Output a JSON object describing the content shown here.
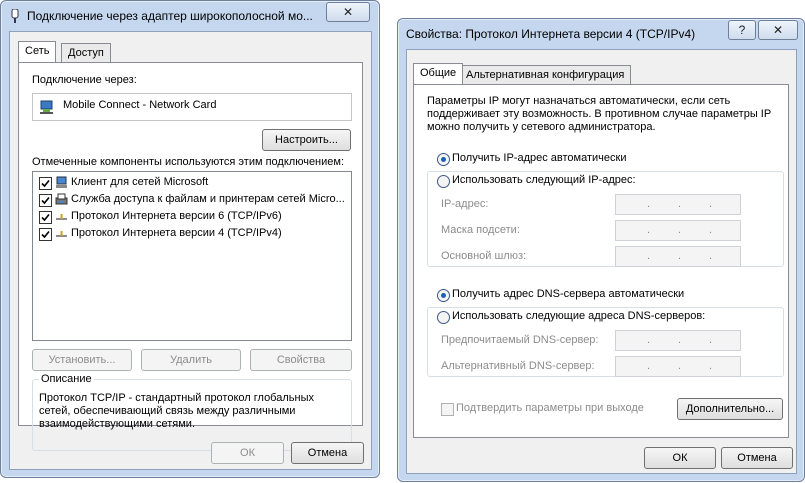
{
  "left_window": {
    "title": "Подключение через адаптер широкополосной мо...",
    "close_glyph": "✕",
    "tabs": [
      "Сеть",
      "Доступ"
    ],
    "connect_through_label": "Подключение через:",
    "adapter_name": "Mobile Connect - Network Card",
    "configure_button": "Настроить...",
    "components_label": "Отмеченные компоненты используются этим подключением:",
    "components": [
      {
        "label": "Клиент для сетей Microsoft",
        "checked": true,
        "icon": "network-client-icon"
      },
      {
        "label": "Служба доступа к файлам и принтерам сетей Micro...",
        "checked": true,
        "icon": "file-printer-sharing-icon"
      },
      {
        "label": "Протокол Интернета версии 6 (TCP/IPv6)",
        "checked": true,
        "icon": "protocol-icon"
      },
      {
        "label": "Протокол Интернета версии 4 (TCP/IPv4)",
        "checked": true,
        "icon": "protocol-icon"
      }
    ],
    "install_button": "Установить...",
    "remove_button": "Удалить",
    "properties_button": "Свойства",
    "description_label": "Описание",
    "description_text": "Протокол TCP/IP - стандартный протокол глобальных сетей, обеспечивающий связь между различными взаимодействующими сетями.",
    "ok_button": "ОК",
    "cancel_button": "Отмена"
  },
  "right_window": {
    "title": "Свойства: Протокол Интернета версии 4 (TCP/IPv4)",
    "help_glyph": "?",
    "close_glyph": "✕",
    "tabs": [
      "Общие",
      "Альтернативная конфигурация"
    ],
    "intro_text": "Параметры IP могут назначаться автоматически, если сеть поддерживает эту возможность. В противном случае параметры IP можно получить у сетевого администратора.",
    "ip_auto_label": "Получить IP-адрес автоматически",
    "ip_manual_label": "Использовать следующий IP-адрес:",
    "ip_address_label": "IP-адрес:",
    "subnet_label": "Маска подсети:",
    "gateway_label": "Основной шлюз:",
    "dns_auto_label": "Получить адрес DNS-сервера автоматически",
    "dns_manual_label": "Использовать следующие адреса DNS-серверов:",
    "preferred_dns_label": "Предпочитаемый DNS-сервер:",
    "alternate_dns_label": "Альтернативный DNS-сервер:",
    "ip_dot": ".",
    "validate_label": "Подтвердить параметры при выходе",
    "advanced_button": "Дополнительно...",
    "ok_button": "ОК",
    "cancel_button": "Отмена",
    "ip_mode": "auto",
    "dns_mode": "auto",
    "validate_checked": false
  }
}
